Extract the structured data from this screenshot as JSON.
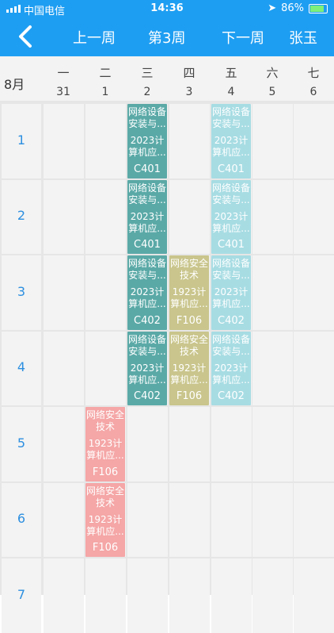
{
  "status": {
    "carrier": "中国电信",
    "time": "14:36",
    "battery": "86%"
  },
  "nav": {
    "prev": "上一周",
    "current": "第3周",
    "next": "下一周",
    "user": "张玉"
  },
  "week": {
    "month": "8月",
    "days": [
      {
        "name": "一",
        "date": "31"
      },
      {
        "name": "二",
        "date": "1"
      },
      {
        "name": "三",
        "date": "2"
      },
      {
        "name": "四",
        "date": "3"
      },
      {
        "name": "五",
        "date": "4"
      },
      {
        "name": "六",
        "date": "5"
      },
      {
        "name": "七",
        "date": "6"
      }
    ]
  },
  "periods": [
    "1",
    "2",
    "3",
    "4",
    "5",
    "6",
    "7"
  ],
  "colors": {
    "teal": "#5aa9a7",
    "lightblue": "#a7dce3",
    "olive": "#c9c58c",
    "pink": "#f5a6a6",
    "header": "#1e9ef2"
  },
  "courses": [
    {
      "day": 2,
      "period": 0,
      "color": "teal",
      "title": "网络设备安装与...",
      "class": "2023计算机应...",
      "room": "C401"
    },
    {
      "day": 4,
      "period": 0,
      "color": "lightblue",
      "title": "网络设备安装与...",
      "class": "2023计算机应...",
      "room": "C401"
    },
    {
      "day": 2,
      "period": 1,
      "color": "teal",
      "title": "网络设备安装与...",
      "class": "2023计算机应...",
      "room": "C401"
    },
    {
      "day": 4,
      "period": 1,
      "color": "lightblue",
      "title": "网络设备安装与...",
      "class": "2023计算机应...",
      "room": "C401"
    },
    {
      "day": 2,
      "period": 2,
      "color": "teal",
      "title": "网络设备安装与...",
      "class": "2023计算机应...",
      "room": "C402"
    },
    {
      "day": 3,
      "period": 2,
      "color": "olive",
      "title": "网络安全技术",
      "class": "1923计算机应...",
      "room": "F106"
    },
    {
      "day": 4,
      "period": 2,
      "color": "lightblue",
      "title": "网络设备安装与...",
      "class": "2023计算机应...",
      "room": "C402"
    },
    {
      "day": 2,
      "period": 3,
      "color": "teal",
      "title": "网络设备安装与...",
      "class": "2023计算机应...",
      "room": "C402"
    },
    {
      "day": 3,
      "period": 3,
      "color": "olive",
      "title": "网络安全技术",
      "class": "1923计算机应...",
      "room": "F106"
    },
    {
      "day": 4,
      "period": 3,
      "color": "lightblue",
      "title": "网络设备安装与...",
      "class": "2023计算机应...",
      "room": "C402"
    },
    {
      "day": 1,
      "period": 4,
      "color": "pink",
      "title": "网络安全技术",
      "class": "1923计算机应...",
      "room": "F106"
    },
    {
      "day": 1,
      "period": 5,
      "color": "pink",
      "title": "网络安全技术",
      "class": "1923计算机应...",
      "room": "F106"
    }
  ]
}
